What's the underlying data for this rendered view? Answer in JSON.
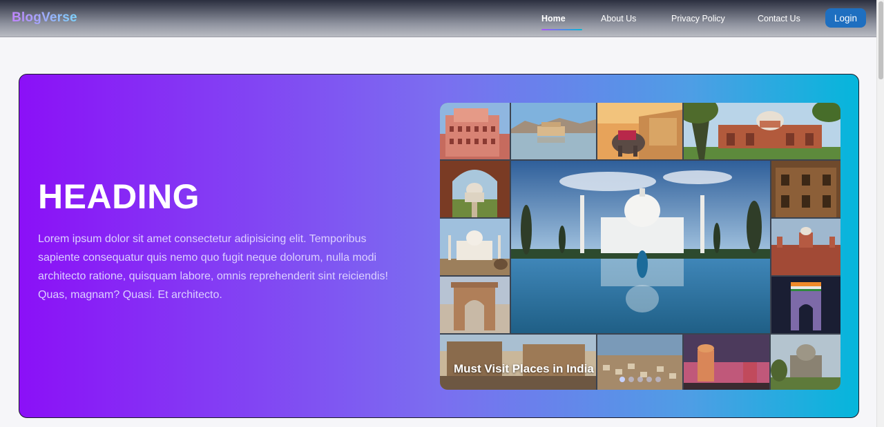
{
  "navbar": {
    "brand": "BlogVerse",
    "links": [
      {
        "label": "Home",
        "active": true
      },
      {
        "label": "About Us",
        "active": false
      },
      {
        "label": "Privacy Policy",
        "active": false
      },
      {
        "label": "Contact Us",
        "active": false
      }
    ],
    "login_label": "Login"
  },
  "hero": {
    "heading": "HEADING",
    "description": "Lorem ipsum dolor sit amet consectetur adipisicing elit. Temporibus sapiente consequatur quis nemo quo fugit neque dolorum, nulla modi architecto ratione, quisquam labore, omnis reprehenderit sint reiciendis! Quas, magnam? Quasi. Et architecto.",
    "carousel": {
      "caption": "Must Visit Places in India",
      "slide_count": 5,
      "active_slide": 1
    }
  },
  "colors": {
    "hero_gradient_start": "#8b10f7",
    "hero_gradient_end": "#05b6db",
    "login_button": "#1e6fc0",
    "brand_gradient": [
      "#c084fc",
      "#7dd3fc"
    ]
  }
}
